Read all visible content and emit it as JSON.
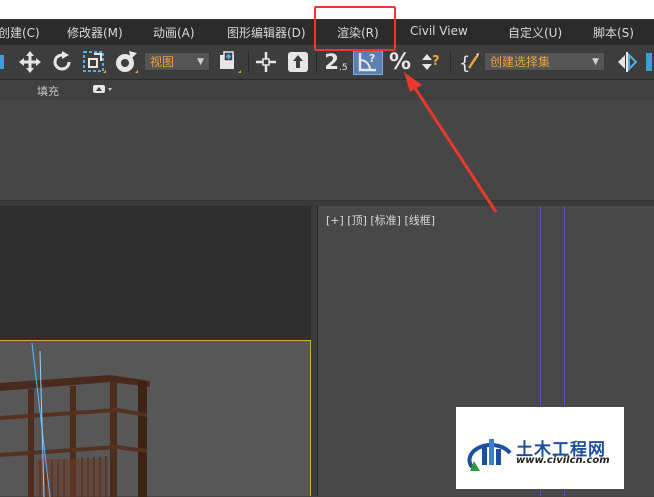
{
  "menu": {
    "items": [
      {
        "label": "创建(C)"
      },
      {
        "label": "修改器(M)"
      },
      {
        "label": "动画(A)"
      },
      {
        "label": "图形编辑器(D)"
      },
      {
        "label": "渲染(R)"
      },
      {
        "label": "Civil View"
      },
      {
        "label": "自定义(U)"
      },
      {
        "label": "脚本(S)"
      }
    ]
  },
  "toolbar": {
    "view_dropdown": "视图",
    "snap_label": "2.5",
    "selection_set_dropdown": "创建选择集"
  },
  "ribbon": {
    "fill_label": "填充"
  },
  "viewport_right": {
    "label": "[+] [顶] [标准] [线框]"
  },
  "watermark": {
    "title": "土木工程网",
    "url": "www.civilcn.com"
  },
  "colors": {
    "highlight": "#e8392d",
    "accent_orange": "#e7a33e",
    "active_viewport_border": "#d4a93b",
    "watermark_blue": "#1e4f9e"
  },
  "icons": [
    "move-icon",
    "rotate-icon",
    "scale-icon",
    "pivot-icon",
    "select-manipulate-icon",
    "keyboard-shortcut-icon",
    "snap-toggle-icon",
    "angle-snap-icon",
    "percent-snap-icon",
    "spinner-snap-icon",
    "edit-named-selection-icon",
    "mirror-icon"
  ]
}
